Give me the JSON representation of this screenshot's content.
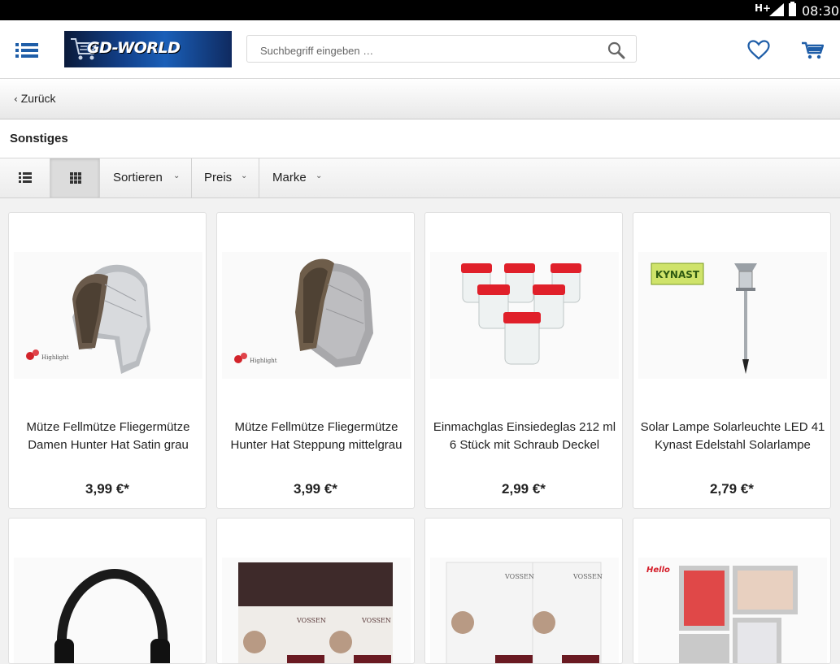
{
  "status_bar": {
    "network": "H+",
    "time": "08:30"
  },
  "header": {
    "logo_text": "GD-WORLD",
    "search_placeholder": "Suchbegriff eingeben …",
    "icons": {
      "menu": "menu-icon",
      "search": "search-icon",
      "wishlist": "heart-icon",
      "cart": "cart-icon"
    }
  },
  "nav": {
    "back_label": "Zurück"
  },
  "category": {
    "title": "Sonstiges"
  },
  "toolbar": {
    "list_view_icon": "list-view-icon",
    "grid_view_icon": "grid-view-icon",
    "sort_label": "Sortieren",
    "price_label": "Preis",
    "brand_label": "Marke"
  },
  "products": [
    {
      "name": "Mütze Fellmütze Fliegermütze Damen Hunter Hat Satin grau",
      "price": "3,99 €*",
      "image": "silver-trapper-hat"
    },
    {
      "name": "Mütze Fellmütze Fliegermütze Hunter Hat Steppung mittelgrau",
      "price": "3,99 €*",
      "image": "grey-trapper-hat"
    },
    {
      "name": "Einmachglas Einsiedeglas 212 ml 6 Stück mit Schraub Deckel",
      "price": "2,99 €*",
      "image": "six-glass-jars-red-lids"
    },
    {
      "name": "Solar Lampe Solarleuchte LED 41 Kynast Edelstahl Solarlampe",
      "price": "2,79 €*",
      "image": "solar-garden-lamp",
      "brand_badge": "KYNAST"
    },
    {
      "name": "",
      "price": "",
      "image": "black-headphones"
    },
    {
      "name": "",
      "price": "",
      "image": "vossen-premium-sheet-brown",
      "brand_badge": "VOSSEN"
    },
    {
      "name": "",
      "price": "",
      "image": "vossen-premium-sheet-white",
      "brand_badge": "VOSSEN"
    },
    {
      "name": "",
      "price": "",
      "image": "photo-frame-collage",
      "brand_badge": "Hello"
    }
  ]
}
